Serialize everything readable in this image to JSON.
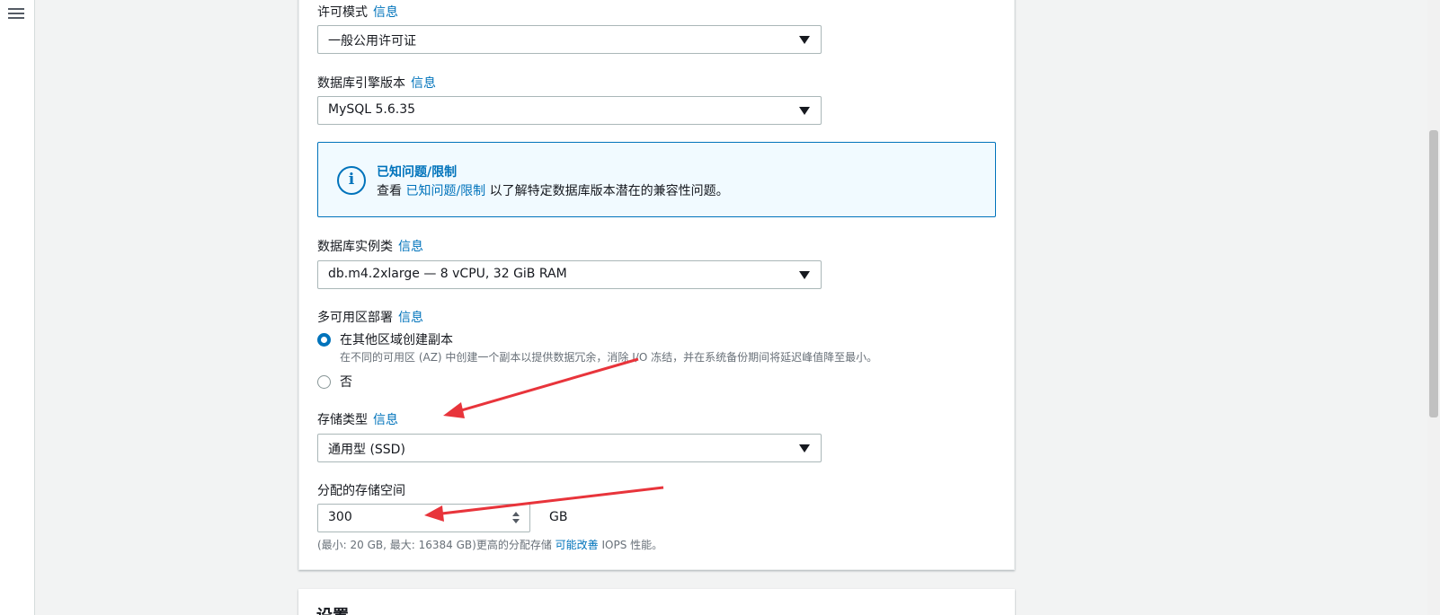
{
  "nav": {
    "menu_icon": "hamburger-menu-icon"
  },
  "license": {
    "label": "许可模式",
    "info": "信息",
    "value": "一般公用许可证"
  },
  "engine_version": {
    "label": "数据库引擎版本",
    "info": "信息",
    "value": "MySQL 5.6.35"
  },
  "alert": {
    "icon": "info-icon",
    "title": "已知问题/限制",
    "text_prefix": "查看",
    "link": "已知问题/限制",
    "text_suffix": "以了解特定数据库版本潜在的兼容性问题。"
  },
  "instance_class": {
    "label": "数据库实例类",
    "info": "信息",
    "value": "db.m4.2xlarge — 8 vCPU, 32 GiB RAM"
  },
  "multi_az": {
    "label": "多可用区部署",
    "info": "信息",
    "options": [
      {
        "label": "在其他区域创建副本",
        "description": "在不同的可用区 (AZ) 中创建一个副本以提供数据冗余，消除 I/O 冻结，并在系统备份期间将延迟峰值降至最小。",
        "selected": true
      },
      {
        "label": "否",
        "selected": false
      }
    ]
  },
  "storage_type": {
    "label": "存储类型",
    "info": "信息",
    "value": "通用型 (SSD)"
  },
  "allocated_storage": {
    "label": "分配的存储空间",
    "value": "300",
    "unit": "GB",
    "hint_prefix": "(最小: 20 GB, 最大: 16384 GB)更高的分配存储",
    "hint_link": "可能改善",
    "hint_suffix": "IOPS 性能。"
  },
  "next_section": {
    "title": "设置"
  },
  "colors": {
    "link": "#0073bb",
    "annotation_arrow": "#e8343b",
    "border": "#aab7b8"
  }
}
